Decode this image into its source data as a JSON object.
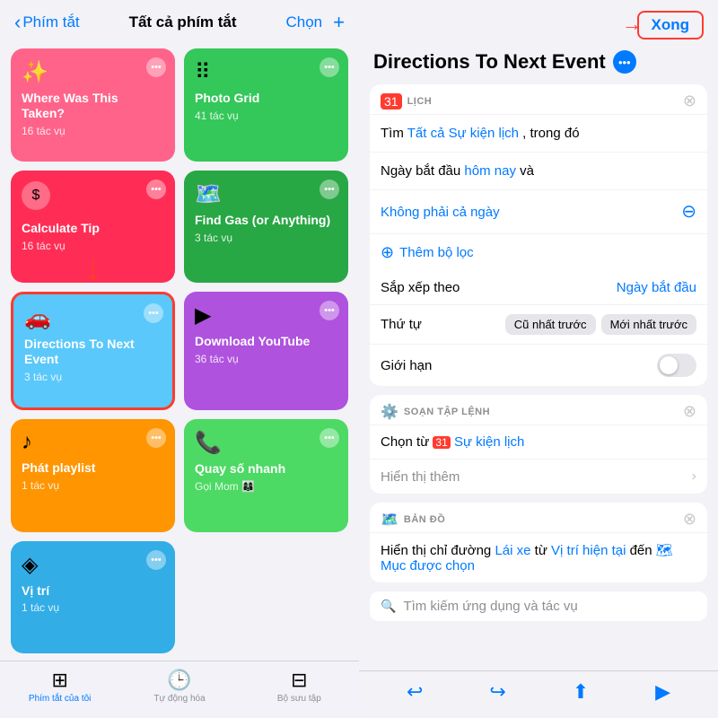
{
  "left": {
    "back_label": "Phím tắt",
    "title": "Tất cả phím tắt",
    "chon": "Chọn",
    "plus": "+",
    "cards": [
      {
        "id": "where",
        "title": "Where Was This Taken?",
        "sub": "16 tác vụ",
        "color": "pink",
        "icon": "✨",
        "selected": false
      },
      {
        "id": "photo",
        "title": "Photo Grid",
        "sub": "41 tác vụ",
        "color": "green",
        "icon": "⠿",
        "selected": false
      },
      {
        "id": "calc",
        "title": "Calculate Tip",
        "sub": "16 tác vụ",
        "color": "red-pink",
        "icon": "$",
        "selected": false
      },
      {
        "id": "gas",
        "title": "Find Gas (or Anything)",
        "sub": "3 tác vụ",
        "color": "dark-green",
        "icon": "🗺",
        "selected": false
      },
      {
        "id": "directions",
        "title": "Directions To Next Event",
        "sub": "3 tác vụ",
        "color": "teal",
        "icon": "🚗",
        "selected": true
      },
      {
        "id": "youtube",
        "title": "Download YouTube",
        "sub": "36 tác vụ",
        "color": "purple",
        "icon": "▶",
        "selected": false
      },
      {
        "id": "playlist",
        "title": "Phát playlist",
        "sub": "1 tác vụ",
        "color": "orange",
        "icon": "♪",
        "selected": false
      },
      {
        "id": "quayso",
        "title": "Quay số nhanh",
        "sub": "Gọi Mom 👩‍👩‍👦👤",
        "color": "green2",
        "icon": "📞",
        "selected": false
      },
      {
        "id": "vitri",
        "title": "Vị trí",
        "sub": "1 tác vụ",
        "color": "cyan",
        "icon": "◈",
        "selected": false
      }
    ],
    "nav": [
      {
        "label": "Phím tắt của tôi",
        "icon": "⊞",
        "active": true
      },
      {
        "label": "Tự động hóa",
        "icon": "🕒",
        "active": false
      },
      {
        "label": "Bộ sưu tập",
        "icon": "⊟",
        "active": false
      }
    ]
  },
  "right": {
    "xong": "Xong",
    "title": "Directions To Next Event",
    "sections": [
      {
        "type": "lich",
        "icon": "31",
        "label": "LỊCH",
        "rows": [
          {
            "text_parts": [
              "Tìm",
              "Tất cả Sự kiện lịch",
              ", trong đó"
            ]
          },
          {
            "text_parts": [
              "Ngày bắt đầu",
              "hôm nay",
              "và"
            ]
          },
          {
            "text_parts": [
              "Không phải cả ngày"
            ]
          }
        ],
        "add_filter": "Thêm bộ lọc",
        "sort_label": "Sắp xếp theo",
        "sort_value": "Ngày bắt đầu",
        "order_label": "Thứ tự",
        "order_options": [
          "Cũ nhất trước",
          "Mới nhất trước"
        ],
        "limit_label": "Giới hạn"
      },
      {
        "type": "script",
        "icon": "⚙",
        "label": "SOẠN TẬP LỆNH",
        "rows": [
          {
            "text_parts": [
              "Chọn từ",
              "31",
              "Sự kiện lịch"
            ]
          },
          {
            "text_parts": [
              "Hiển thị thêm"
            ]
          }
        ]
      },
      {
        "type": "map",
        "icon": "🗺",
        "label": "BẢN ĐỒ",
        "rows": [
          {
            "text_parts": [
              "Hiển thị chỉ đường",
              "Lái xe",
              "từ",
              "Vị trí hiện tại",
              "đến",
              "🗺 Mục được chọn"
            ]
          }
        ]
      }
    ],
    "search_placeholder": "Tìm kiếm ứng dụng và tác vụ",
    "toolbar": {
      "undo": "↩",
      "redo": "↪",
      "share": "⬆",
      "play": "▶"
    }
  }
}
